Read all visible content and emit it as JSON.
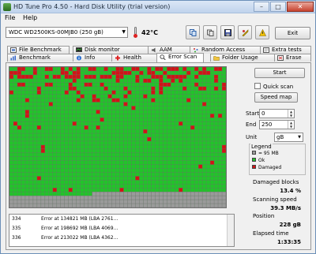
{
  "window": {
    "title": "HD Tune Pro 4.50 - Hard Disk Utility (trial version)",
    "minimize": "–",
    "maximize": "□",
    "close": "✕"
  },
  "menu": {
    "file": "File",
    "help": "Help"
  },
  "toolbar": {
    "drive": "WDC WD2500KS-00MJB0 (250 gB)",
    "temperature": "42°C",
    "exit_label": "Exit",
    "icons": [
      "copy-info-icon",
      "copy-screenshot-icon",
      "save-icon",
      "options-icon",
      "help-icon"
    ]
  },
  "tabs_top": [
    {
      "label": "File Benchmark",
      "icon": "file-benchmark-icon"
    },
    {
      "label": "Disk monitor",
      "icon": "disk-monitor-icon"
    },
    {
      "label": "AAM",
      "icon": "aam-icon"
    },
    {
      "label": "Random Access",
      "icon": "random-access-icon"
    },
    {
      "label": "Extra tests",
      "icon": "extra-tests-icon"
    }
  ],
  "tabs_bottom": [
    {
      "label": "Benchmark",
      "icon": "benchmark-icon"
    },
    {
      "label": "Info",
      "icon": "info-icon"
    },
    {
      "label": "Health",
      "icon": "health-icon"
    },
    {
      "label": "Error Scan",
      "icon": "error-scan-icon",
      "active": true
    },
    {
      "label": "Folder Usage",
      "icon": "folder-usage-icon"
    },
    {
      "label": "Erase",
      "icon": "erase-icon"
    }
  ],
  "controls": {
    "start_label": "Start",
    "quick_scan_label": "Quick scan",
    "speed_map_label": "Speed map",
    "start_field_label": "Start",
    "start_value": "0",
    "end_field_label": "End",
    "end_value": "250",
    "unit_label": "Unit",
    "unit_value": "gB"
  },
  "legend": {
    "title": "Legend",
    "items": [
      {
        "label": "= 95 MB",
        "color": "#9a9a9a"
      },
      {
        "label": "Ok",
        "color": "#22c32a"
      },
      {
        "label": "Damaged",
        "color": "#d11416"
      }
    ]
  },
  "stats": {
    "damaged_blocks_label": "Damaged blocks",
    "damaged_blocks_value": "13.4 %",
    "scanning_speed_label": "Scanning speed",
    "scanning_speed_value": "39.3 MB/s",
    "position_label": "Position",
    "position_value": "228 gB",
    "elapsed_label": "Elapsed time",
    "elapsed_value": "1:33:35"
  },
  "log": [
    {
      "no": "334",
      "msg": "Error at 134821 MB (LBA 2761..."
    },
    {
      "no": "335",
      "msg": "Error at 198692 MB (LBA 4069..."
    },
    {
      "no": "336",
      "msg": "Error at 213022 MB (LBA 4362..."
    }
  ],
  "block_colors": {
    "ok": "#22c32a",
    "damaged": "#d11416",
    "unscanned": "#9a9a9a"
  }
}
